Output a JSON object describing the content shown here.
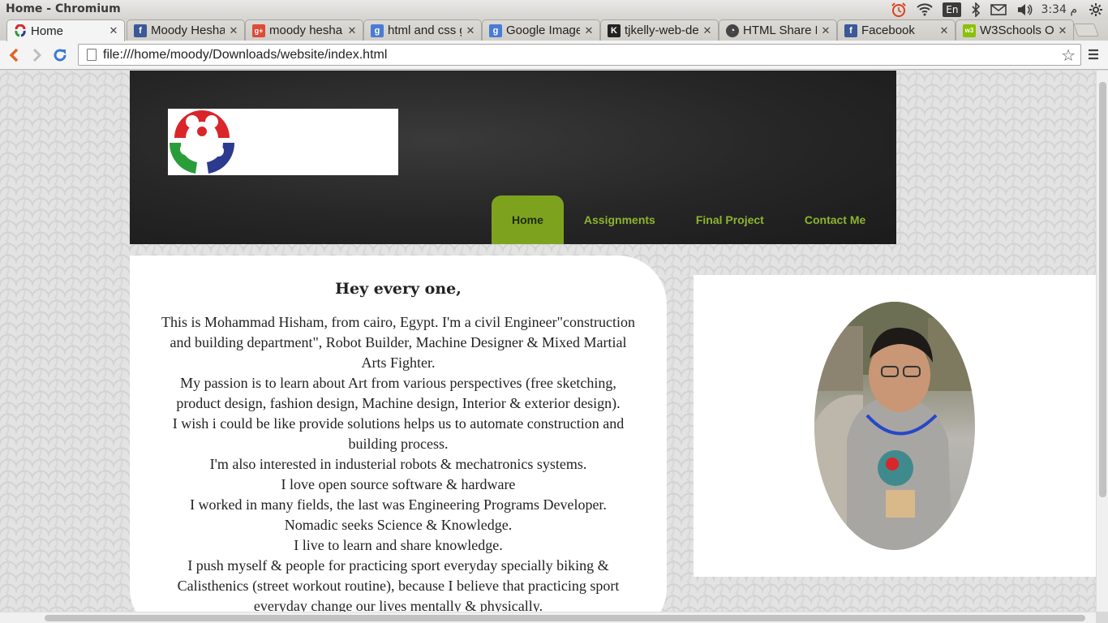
{
  "os": {
    "window_title": "Home - Chromium",
    "keyboard_lang": "En",
    "clock": "3:34 م"
  },
  "tabs": [
    {
      "label": "Home",
      "icon": "fablab-favicon",
      "active": true
    },
    {
      "label": "Moody Hesha",
      "icon": "facebook-favicon"
    },
    {
      "label": "moody hesha",
      "icon": "google-plus-favicon"
    },
    {
      "label": "html and css g",
      "icon": "google-favicon"
    },
    {
      "label": "Google Image",
      "icon": "google-favicon"
    },
    {
      "label": "tjkelly-web-de",
      "icon": "github-favicon"
    },
    {
      "label": "HTML Share B",
      "icon": "share-favicon"
    },
    {
      "label": "Facebook",
      "icon": "facebook-favicon"
    },
    {
      "label": "W3Schools O",
      "icon": "w3schools-favicon"
    }
  ],
  "toolbar": {
    "url": "file:///home/moody/Downloads/website/index.html"
  },
  "site": {
    "nav": [
      {
        "label": "Home",
        "current": true
      },
      {
        "label": "Assignments"
      },
      {
        "label": "Final Project"
      },
      {
        "label": "Contact Me"
      }
    ],
    "greeting": "Hey every one,",
    "bio_lines": [
      "This is Mohammad Hisham, from cairo, Egypt. I'm a civil Engineer\"construction and building department\", Robot Builder, Machine Designer & Mixed Martial Arts Fighter.",
      "My passion is to learn about Art from various perspectives (free sketching, product design, fashion design, Machine design, Interior & exterior design).",
      "I wish i could be like provide solutions helps us to automate construction and building process.",
      "I'm also interested in industerial robots & mechatronics systems.",
      "I love open source software & hardware",
      "I worked in many fields, the last was Engineering Programs Developer.",
      "Nomadic seeks Science & Knowledge.",
      "I live to learn and share knowledge.",
      "I push myself & people for practicing sport everyday specially biking & Calisthenics (street workout routine), because I believe that practicing sport everyday change our lives mentally & physically."
    ]
  },
  "colors": {
    "nav_green": "#8db52e",
    "nav_active_bg": "#7da31e",
    "header_dark": "#262626"
  }
}
